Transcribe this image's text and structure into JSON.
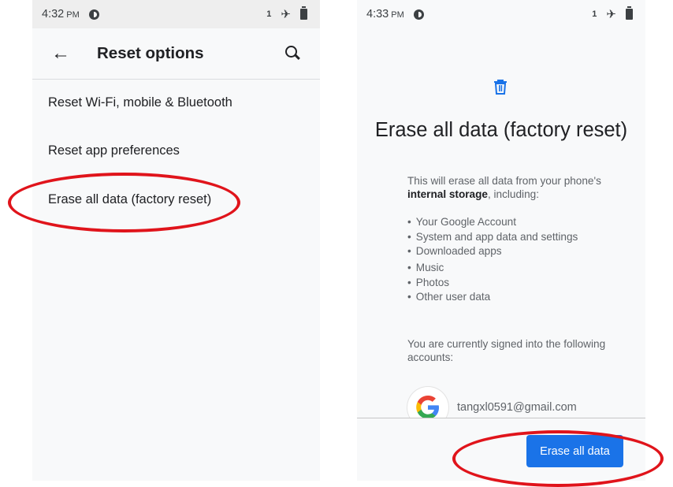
{
  "left_screen": {
    "status_bar": {
      "time": "4:32",
      "ampm": "PM",
      "sim_indicator": "1",
      "icons": [
        "dnd-icon",
        "airplane-icon",
        "battery-icon"
      ]
    },
    "app_bar": {
      "title": "Reset options",
      "back_icon": "arrow-back-icon",
      "search_icon": "search-icon"
    },
    "menu_items": [
      {
        "label": "Reset Wi-Fi, mobile & Bluetooth"
      },
      {
        "label": "Reset app preferences"
      },
      {
        "label": "Erase all data (factory reset)",
        "highlighted": true
      }
    ]
  },
  "right_screen": {
    "status_bar": {
      "time": "4:33",
      "ampm": "PM",
      "sim_indicator": "1",
      "icons": [
        "dnd-icon",
        "airplane-icon",
        "battery-icon"
      ]
    },
    "header_icon": "trash-icon",
    "title": "Erase all data (factory reset)",
    "description_prefix": "This will erase all data from your phone's",
    "description_bold": "internal storage",
    "description_suffix": ", including:",
    "items": [
      "Your Google Account",
      "System and app data and settings",
      "Downloaded apps",
      "Music",
      "Photos",
      "Other user data"
    ],
    "signed_in_text": "You are currently signed into the following accounts:",
    "account": {
      "email": "tangxl0591@gmail.com",
      "icon": "google-logo-icon"
    },
    "erase_button_label": "Erase all data",
    "erase_button_highlighted": true
  },
  "colors": {
    "accent": "#1a73e8",
    "annotation_red": "#e0141b",
    "background": "#f8f9fa"
  }
}
